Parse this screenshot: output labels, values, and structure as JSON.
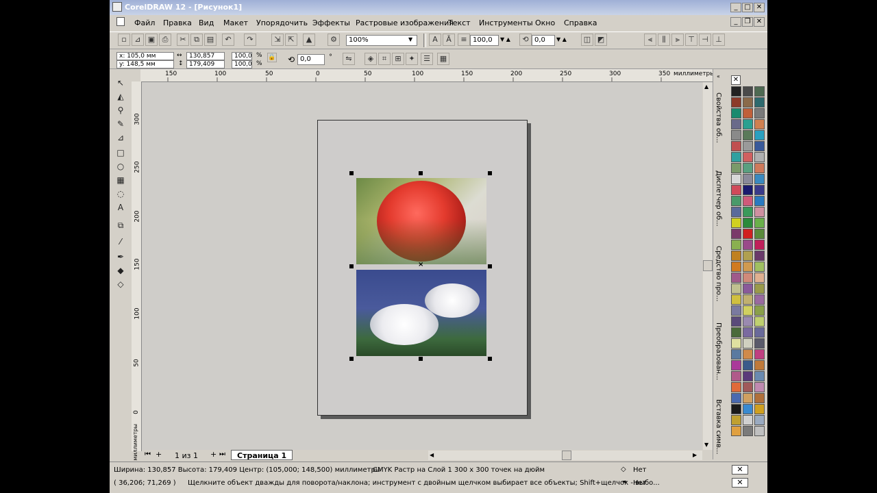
{
  "window": {
    "title": "CorelDRAW 12 - [Рисунок1]"
  },
  "menu": [
    "Файл",
    "Правка",
    "Вид",
    "Макет",
    "Упорядочить",
    "Эффекты",
    "Растровые изображения",
    "Текст",
    "Инструменты",
    "Окно",
    "Справка"
  ],
  "toolbar": {
    "zoom": "100%",
    "font_size": "100,0",
    "angle": "0,0"
  },
  "property_bar": {
    "x": "x: 105,0 мм",
    "y": "y: 148,5 мм",
    "width": "130,857 мм",
    "height": "179,409 мм",
    "scale_w": "100,0",
    "scale_h": "100,0",
    "pct1": "%",
    "pct2": "%",
    "rotation": "0,0",
    "deg": "°"
  },
  "ruler_h": {
    "labels": [
      "150",
      "100",
      "50",
      "0",
      "50",
      "100",
      "150",
      "200",
      "250",
      "300",
      "350"
    ],
    "unit": "миллиметры"
  },
  "ruler_v": {
    "labels": [
      "300",
      "250",
      "200",
      "150",
      "100",
      "50",
      "0"
    ],
    "unit": "миллиметры"
  },
  "page_nav": {
    "counter": "1 из 1",
    "tab": "Страница 1"
  },
  "dockers": [
    "Свойства об...",
    "Диспетчер об...",
    "Средство про...",
    "Преобразован...",
    "Вставка симв..."
  ],
  "status": {
    "line1": "Ширина: 130,857  Высота: 179,409  Центр: (105,000; 148,500)  миллиметры",
    "layer": "CMYK Растр на Слой 1 300 x 300 точек на дюйм",
    "coords": "( 36,206; 71,269 )",
    "hint": "Щелкните объект дважды для поворота/наклона; инструмент с двойным щелчком выбирает все объекты; Shift+щелчок - выбо...",
    "fill": "Нет",
    "outline": "Нет"
  },
  "palette_colors": [
    "#222222",
    "#4a4a4a",
    "#4e6a52",
    "#8c3a2a",
    "#8a6a4a",
    "#2e6a6e",
    "#1a8a6e",
    "#c0603a",
    "#7a7a7a",
    "#6a6a8a",
    "#2aa090",
    "#d08050",
    "#8a8a8a",
    "#5a7a5a",
    "#2aa0c0",
    "#c05050",
    "#9a9a9a",
    "#3a5a9a",
    "#30a0a0",
    "#d06060",
    "#b0b0b0",
    "#7a9a6a",
    "#5aa080",
    "#d07a5a",
    "#d8d8d8",
    "#8a8a9a",
    "#3a8ac0",
    "#d04a5a",
    "#1a1a6e",
    "#3a3a8a",
    "#4a9a6a",
    "#d05a7a",
    "#2a7ac0",
    "#5a6a9a",
    "#3a9a5a",
    "#d090a0",
    "#d0d020",
    "#2a8a3a",
    "#6ab04a",
    "#7a3a6a",
    "#d02020",
    "#5a8a3a",
    "#8ab050",
    "#9a4a8a",
    "#c0205a",
    "#c08020",
    "#b0a050",
    "#6a3a6a",
    "#d07a20",
    "#d09a50",
    "#a0c060",
    "#a05a8a",
    "#d08a7a",
    "#e0b090",
    "#c0c090",
    "#8a5a9a",
    "#9a9a4a",
    "#d0c040",
    "#c0b070",
    "#9a6aa0",
    "#7a7aa0",
    "#d0d060",
    "#8aa04a",
    "#5a4a7a",
    "#9a8ab0",
    "#c0d070",
    "#4a6a3a",
    "#7a6aa0",
    "#6a6a9a",
    "#e0e0a0",
    "#d0d0c0",
    "#5a5a6a",
    "#5a7aa0",
    "#d08a4a",
    "#c04080",
    "#aa3a9a",
    "#3a5a8a",
    "#c07a3a",
    "#b05a8a",
    "#5a3a7a",
    "#6a8ab0",
    "#e06a3a",
    "#a05a5a",
    "#c08ab0",
    "#4a6ab0",
    "#d0a060",
    "#b0703a",
    "#1a1a1a",
    "#3a8ad0",
    "#d0a020",
    "#c0a030",
    "#d0d0d0",
    "#9aaac0",
    "#e0a040",
    "#7a7a7a",
    "#c0c0c0"
  ]
}
